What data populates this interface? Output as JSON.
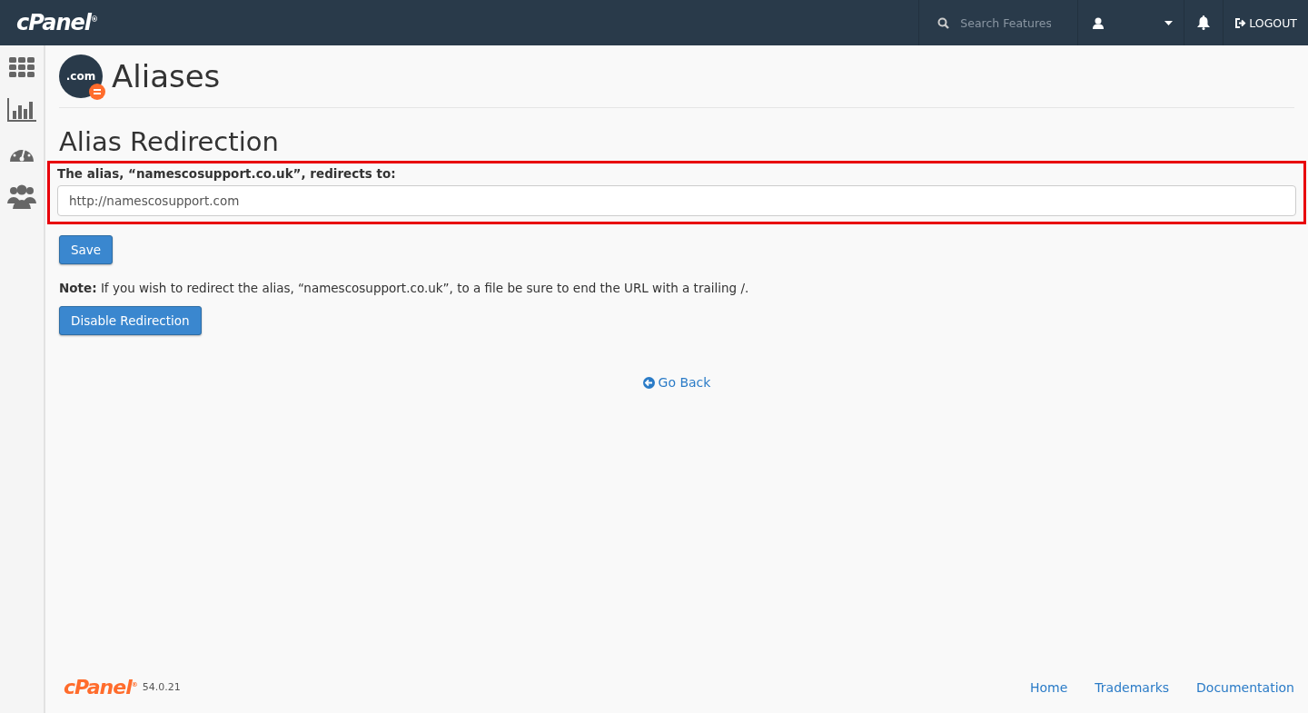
{
  "header": {
    "logo": "cPanel$^{®}$",
    "search": {
      "placeholder": "Search Features"
    },
    "logout": "LOGOUT"
  },
  "sidebar": {
    "items": [
      {
        "kind": "grid",
        "selected": false
      },
      {
        "kind": "stats",
        "selected": false
      },
      {
        "kind": "gauge",
        "selected": false
      },
      {
        "kind": "users",
        "selected": false
      }
    ]
  },
  "page": {
    "icon_text": ".com",
    "title": "Aliases",
    "section_title": "Alias Redirection",
    "field_label": "The alias, “namescosupport.co.uk”, redirects to:",
    "field_value": "http://namescosupport.com",
    "save_button": "Save",
    "note": "**Note:** If you wish to redirect the alias, “namescosupport.co.uk”, to a file be sure to end the URL with a trailing /.",
    "disable_button": "Disable Redirection",
    "go_back": "Go Back"
  },
  "footer": {
    "logo": "cPanel$^{®}$",
    "version": "54.0.21",
    "links": [
      "Home",
      "Trademarks",
      "Documentation"
    ]
  }
}
